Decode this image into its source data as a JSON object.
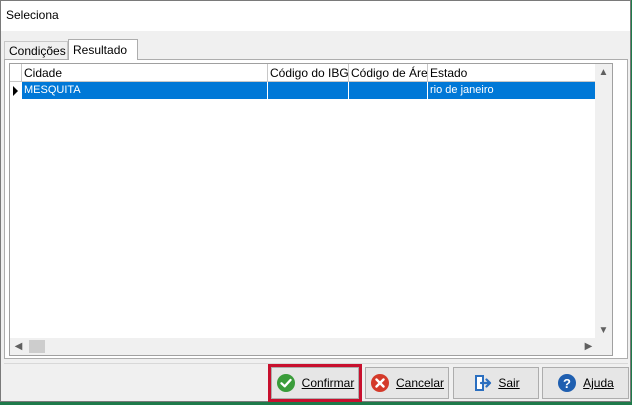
{
  "window": {
    "title": "Seleciona"
  },
  "tabs": [
    {
      "label": "Condições",
      "active": false
    },
    {
      "label": "Resultado",
      "active": true
    }
  ],
  "grid": {
    "columns": [
      "Cidade",
      "Código do IBGE",
      "Código de Área",
      "Estado"
    ],
    "rows": [
      {
        "cidade": "MESQUITA",
        "codigo_ibge": "",
        "codigo_area": "",
        "estado": "rio de janeiro",
        "selected": true
      }
    ]
  },
  "buttons": {
    "confirmar": {
      "label": "Confirmar",
      "icon": "check-circle-icon",
      "color": "#3a9c3a"
    },
    "cancelar": {
      "label": "Cancelar",
      "icon": "x-circle-icon",
      "color": "#d43a2a"
    },
    "sair": {
      "label": "Sair",
      "icon": "exit-door-icon",
      "color": "#2b6fc0"
    },
    "ajuda": {
      "label": "Ajuda",
      "icon": "question-circle-icon",
      "color": "#1f5fb0"
    }
  },
  "colors": {
    "selection": "#0078d7",
    "focus_outline": "#c8102e"
  }
}
